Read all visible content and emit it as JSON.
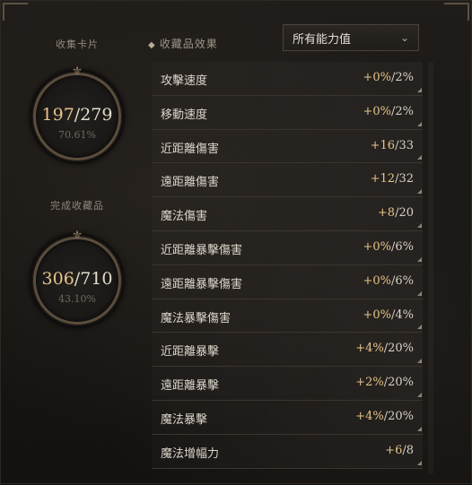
{
  "cards": {
    "label": "收集卡片",
    "current": "197",
    "total": "279",
    "percent": "70.61%",
    "fraction": 0.7061
  },
  "collectibles": {
    "label": "完成收藏品",
    "current": "306",
    "total": "710",
    "percent": "43.10%",
    "fraction": 0.431
  },
  "effects": {
    "label": "收藏品效果",
    "dropdown_value": "所有能力值"
  },
  "stats": [
    {
      "name": "攻擊速度",
      "current": "+0%",
      "max": "/2%"
    },
    {
      "name": "移動速度",
      "current": "+0%",
      "max": "/2%"
    },
    {
      "name": "近距離傷害",
      "current": "+16",
      "max": "/33"
    },
    {
      "name": "遠距離傷害",
      "current": "+12",
      "max": "/32"
    },
    {
      "name": "魔法傷害",
      "current": "+8",
      "max": "/20"
    },
    {
      "name": "近距離暴擊傷害",
      "current": "+0%",
      "max": "/6%"
    },
    {
      "name": "遠距離暴擊傷害",
      "current": "+0%",
      "max": "/6%"
    },
    {
      "name": "魔法暴擊傷害",
      "current": "+0%",
      "max": "/4%"
    },
    {
      "name": "近距離暴擊",
      "current": "+4%",
      "max": "/20%"
    },
    {
      "name": "遠距離暴擊",
      "current": "+2%",
      "max": "/20%"
    },
    {
      "name": "魔法暴擊",
      "current": "+4%",
      "max": "/20%"
    },
    {
      "name": "魔法增幅力",
      "current": "+6",
      "max": "/8"
    }
  ],
  "icons": {
    "dropdown": "chevron-down-icon",
    "filter": "diamond-icon",
    "ring_ornament": "fleur-ornament-icon"
  },
  "colors": {
    "gold": "#e6c48a",
    "ring": "#5a4d3c"
  }
}
